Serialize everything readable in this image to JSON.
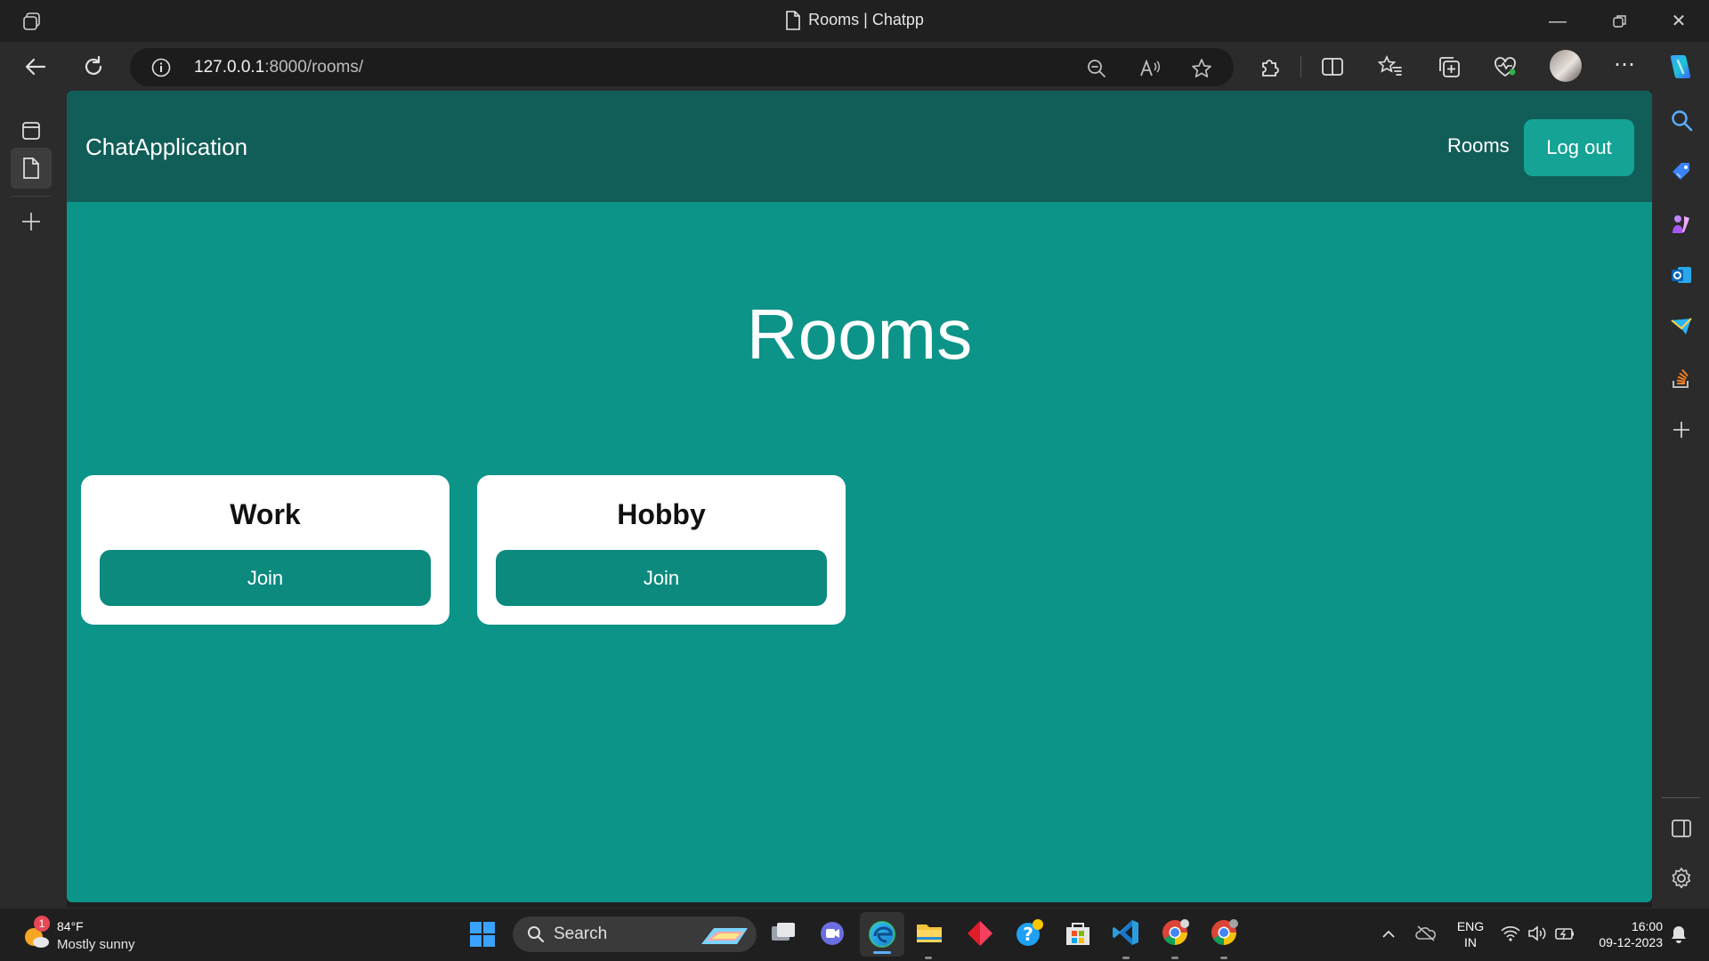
{
  "window": {
    "title": "Rooms | Chatpp"
  },
  "address_bar": {
    "url_host": "127.0.0.1",
    "url_rest": ":8000/rooms/"
  },
  "page": {
    "brand": "ChatApplication",
    "nav": {
      "rooms_label": "Rooms",
      "logout_label": "Log out"
    },
    "heading": "Rooms",
    "rooms": [
      {
        "name": "Work",
        "join_label": "Join"
      },
      {
        "name": "Hobby",
        "join_label": "Join"
      }
    ],
    "colors": {
      "navbar": "#115e59",
      "background": "#0d9488",
      "button": "#0d8a7e"
    }
  },
  "taskbar": {
    "weather": {
      "temperature": "84°F",
      "condition": "Mostly sunny",
      "badge": "1"
    },
    "search_label": "Search",
    "language": "ENG",
    "region": "IN",
    "time": "16:00",
    "date": "09-12-2023"
  }
}
